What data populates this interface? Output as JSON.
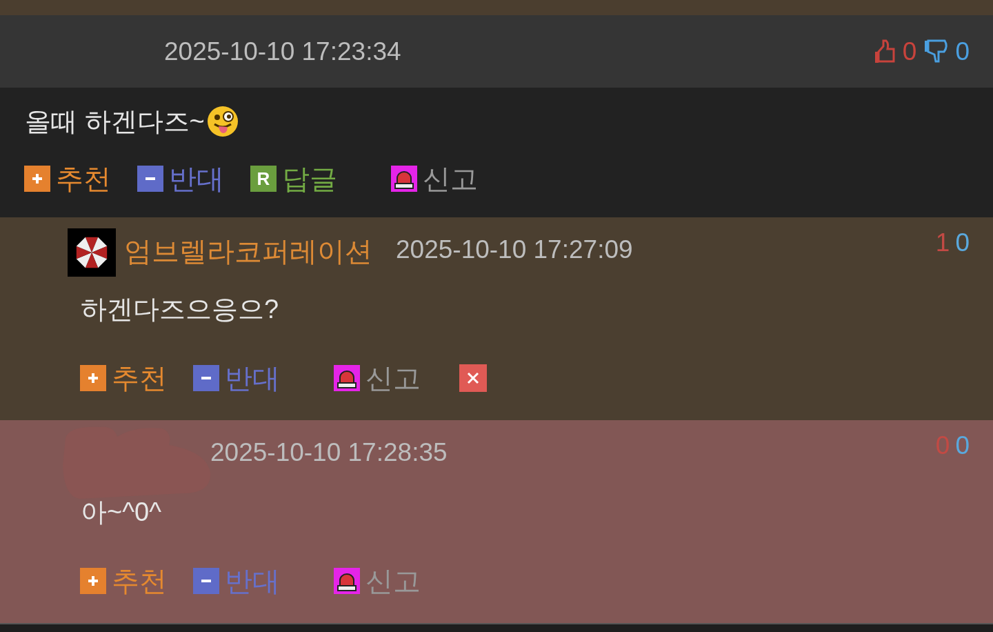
{
  "comments": [
    {
      "kind": "comment",
      "color": "#353535",
      "date": "2025-10-10 17:23:34",
      "vote_icons": true,
      "up": "0",
      "down": "0",
      "text": "올때 하겐다즈~",
      "emoji": true,
      "actions": [
        {
          "kind": "up",
          "label": "추천"
        },
        {
          "kind": "down",
          "label": "반대"
        },
        {
          "kind": "reply",
          "label": "답글",
          "icon_text": "R"
        },
        {
          "kind": "report",
          "label": "신고"
        }
      ]
    },
    {
      "kind": "reply",
      "color": "#4b3f30",
      "author": "엄브렐라코퍼레이션",
      "date": "2025-10-10 17:27:09",
      "vote_icons": false,
      "up": "1",
      "down": "0",
      "text": "하겐다즈으응으?",
      "emoji": false,
      "actions": [
        {
          "kind": "up",
          "label": "추천"
        },
        {
          "kind": "down",
          "label": "반대"
        },
        {
          "kind": "report",
          "label": "신고"
        },
        {
          "kind": "delete"
        }
      ]
    },
    {
      "kind": "reply",
      "color": "#825755",
      "author_redacted": true,
      "date": "2025-10-10 17:28:35",
      "vote_icons": false,
      "up": "0",
      "down": "0",
      "text": "아~^0^",
      "emoji": false,
      "actions": [
        {
          "kind": "up",
          "label": "추천"
        },
        {
          "kind": "down",
          "label": "반대"
        },
        {
          "kind": "report",
          "label": "신고"
        }
      ]
    }
  ]
}
